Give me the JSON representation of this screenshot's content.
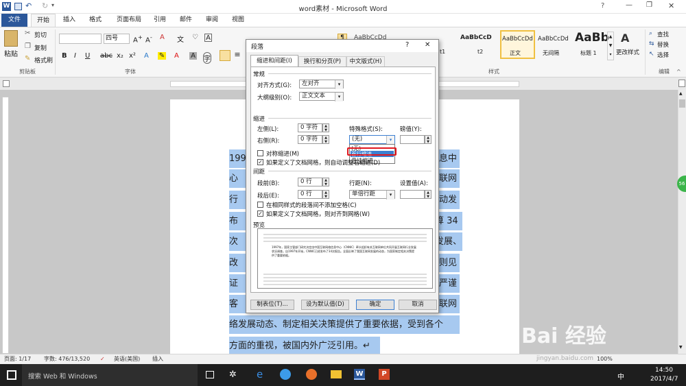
{
  "app": {
    "title": "word素材 - Microsoft Word",
    "help": "?",
    "win_min": "—",
    "win_restore": "❐",
    "win_close": "✕"
  },
  "tabs": [
    "文件",
    "开始",
    "插入",
    "格式",
    "页面布局",
    "引用",
    "邮件",
    "审阅",
    "视图"
  ],
  "ribbon": {
    "paste": "粘贴",
    "cut": "剪切",
    "copy": "复制",
    "format_painter": "格式刷",
    "clipboard_group": "剪贴板",
    "font_size": "四号",
    "font_group": "字体",
    "styles": [
      {
        "preview": "AaBbCcDd",
        "name": "t1"
      },
      {
        "preview": "AaBbCcD",
        "name": "t2"
      },
      {
        "preview": "AaBbCcDd",
        "name": "正文"
      },
      {
        "preview": "AaBbCcDd",
        "name": "无间隔"
      },
      {
        "preview": "AaBb",
        "name": "标题 1"
      }
    ],
    "change_styles": "更改样式",
    "styles_group": "样式",
    "find": "查找",
    "replace": "替换",
    "select": "选择",
    "editing_group": "编辑"
  },
  "document": {
    "lines": [
      {
        "left": "199",
        "right": "息中"
      },
      {
        "left": "心",
        "right": "联网"
      },
      {
        "left": "行业",
        "right": "动发"
      },
      {
        "left": "布了",
        "right": "算 34"
      },
      {
        "left": "次报",
        "right": "发展、"
      },
      {
        "left": "改变",
        "right": "则见"
      },
      {
        "left": "证了",
        "right": "严谨"
      },
      {
        "left": "客观",
        "right": "联网"
      },
      {
        "full": "络发展动态、制定相关决策提供了重要依据，受到各个"
      },
      {
        "full": "方面的重视，被国内外广泛引用。↵"
      }
    ]
  },
  "dialog": {
    "title": "段落",
    "help": "?",
    "close": "✕",
    "tabs": [
      "缩进和间距(I)",
      "换行和分页(P)",
      "中文版式(H)"
    ],
    "general_section": "常规",
    "align_label": "对齐方式(G):",
    "align_value": "左对齐",
    "outline_label": "大纲级别(O):",
    "outline_value": "正文文本",
    "indent_section": "缩进",
    "left_label": "左侧(L):",
    "left_value": "0 字符",
    "right_label": "右侧(R):",
    "right_value": "0 字符",
    "special_label": "特殊格式(S):",
    "special_value": "(无)",
    "special_options": [
      "(无)",
      "首行缩进",
      "悬挂缩进"
    ],
    "magnitude_label": "磅值(Y):",
    "mirror_label": "对称缩进(M)",
    "grid_indent_label": "如果定义了文档网格，则自动调整右缩进(D)",
    "spacing_section": "间距",
    "before_label": "段前(B):",
    "before_value": "0 行",
    "after_label": "段后(E):",
    "after_value": "0 行",
    "line_spacing_label": "行距(N):",
    "line_spacing_value": "单倍行距",
    "set_value_label": "设置值(A):",
    "no_space_label": "在相同样式的段落间不添加空格(C)",
    "snap_grid_label": "如果定义了文档网格，则对齐到网格(W)",
    "preview_section": "预览",
    "preview_text": "1997年，国家主管部门研究决定由中国互联网络信息中心（CNNIC）牵头组织有关互联网单位共同开展互联网行业发展状况调查。自1997年开始，CNNIC已经发布了34次报告。全面反映了我国互联网发展的动态，为国家制定相关决策提供了重要依据。",
    "tab_button": "制表位(T)...",
    "default_button": "设为默认值(D)",
    "ok_button": "确定",
    "cancel_button": "取消"
  },
  "status": {
    "page": "页面: 1/17",
    "words": "字数: 476/13,520",
    "language": "英语(美国)",
    "mode": "插入",
    "zoom": "100%"
  },
  "taskbar": {
    "search": "搜索 Web 和 Windows",
    "time": "14:50",
    "date": "2017/4/7",
    "ime": "中",
    "watermark": "Bai 经验",
    "watermark_url": "jingyan.baidu.com"
  },
  "colors": {
    "word_blue": "#2b579a",
    "selection": "#a7c9f0",
    "highlight_red": "#e0161e",
    "dialog_bg": "#f0f0f0"
  }
}
